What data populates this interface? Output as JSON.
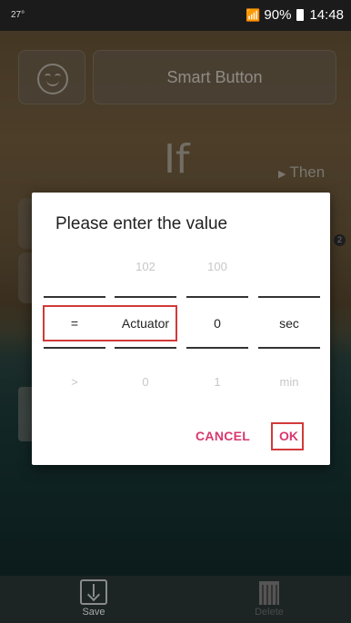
{
  "status_bar": {
    "left_text": "27°",
    "signal_text": "↯▕▁▂▃",
    "battery_text": "90%",
    "time": "14:48"
  },
  "background_screen": {
    "button_label": "Smart Button",
    "if_label": "If",
    "then_label": "Then",
    "badge": "2"
  },
  "dialog": {
    "title": "Please enter the value",
    "columns": [
      {
        "above": "",
        "selected": "=",
        "below": ">"
      },
      {
        "above": "102",
        "selected": "Actuator",
        "below": "0"
      },
      {
        "above": "100",
        "selected": "0",
        "below": "1"
      },
      {
        "above": "",
        "selected": "sec",
        "below": "min"
      }
    ],
    "cancel_label": "CANCEL",
    "ok_label": "OK"
  },
  "bottom_bar": {
    "save_label": "Save",
    "delete_label": "Delete"
  },
  "colors": {
    "accent": "#d9386f",
    "highlight": "#d23a3a"
  }
}
